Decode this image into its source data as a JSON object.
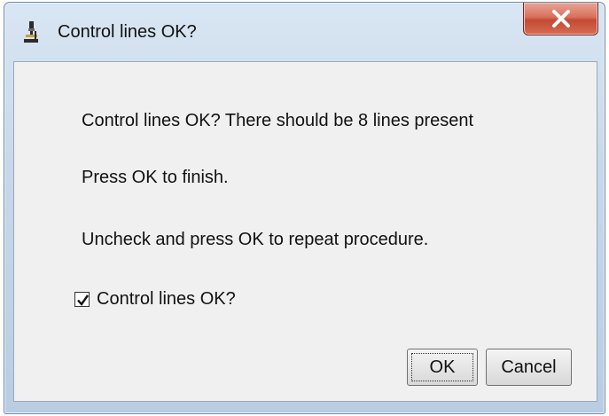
{
  "window": {
    "title": "Control lines OK?",
    "app_icon": "microscope-icon",
    "close_icon": "close-icon"
  },
  "message": {
    "line1": "Control lines OK? There should be 8 lines present",
    "line2": "Press OK to finish.",
    "line3": "Uncheck and press OK to repeat procedure."
  },
  "checkbox": {
    "label": "Control lines OK?",
    "checked": true
  },
  "buttons": {
    "ok_label": "OK",
    "cancel_label": "Cancel"
  },
  "colors": {
    "close_button": "#c24a33",
    "dialog_background": "#f0f0f0",
    "frame": "#c7d8ea"
  }
}
